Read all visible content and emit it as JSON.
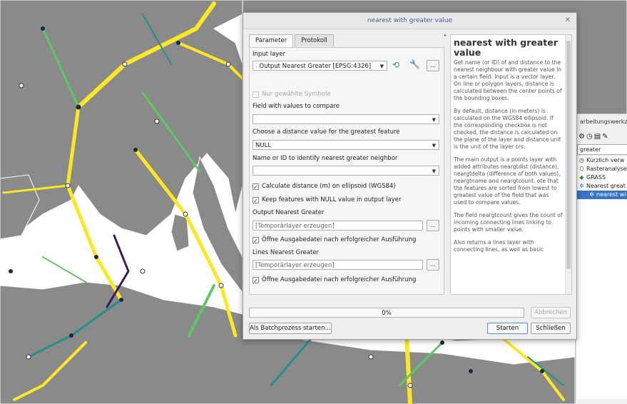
{
  "dialog": {
    "title": "nearest with greater value",
    "tabs": [
      "Parameter",
      "Protokoll"
    ],
    "input_layer_label": "Input layer",
    "input_layer_value": "Output Nearest Greater [EPSG:4326]",
    "selected_only_label": "Nur gewählte Symbole",
    "field_compare_label": "Field with values to compare",
    "field_compare_value": "",
    "distance_label": "Choose a distance value for the greatest feature",
    "distance_value": "NULL",
    "name_label": "Name or ID to identify nearest greater neighbor",
    "name_value": "",
    "calc_ellipsoid_label": "Calculate distance (m) on ellipsoid (WGS84)",
    "keep_null_label": "Keep features with NULL value in output layer",
    "output_label": "Output Nearest Greater",
    "output_placeholder": "[Temporärlayer erzeugen]",
    "open_after_label": "Öffne Ausgabedatei nach erfolgreicher Ausführung",
    "lines_label": "Lines Nearest Greater",
    "lines_placeholder": "[Temporärlayer erzeugen]",
    "open_after_label2": "Öffne Ausgabedatei nach erfolgreicher Ausführung",
    "ellipsis": "...",
    "progress": "0%",
    "cancel": "Abbrechen",
    "batch": "Als Batchprozess starten…",
    "start": "Starten",
    "close": "Schließen"
  },
  "help": {
    "title": "nearest with greater value",
    "paragraphs": [
      "Get name (or ID) of and distance to the nearest neighbour with greater value in a certain field. Input is a vector layer. On line or polygon layers, distance is calculated between the center points of the bounding boxes.",
      "By default, distance (in meters) is calculated on the WGS84 ellipsoid. If the corresponding checkbox is not checked, the distance is calculated on the plane of the layer and distance unit is the unit of the layer crs.",
      "The main output is a points layer with added attributes neargtdist (distance), neargtdelta (difference of both values), neargtname and neargtcount. ote that the features are sorted from lowest to greatest value of the field that was used to compare values.",
      "The field neargtcount gives the count of incoming connecting lines linking to points with smaller value.",
      "Also returns a lines layer with connecting lines, as well as basic"
    ]
  },
  "toolbox": {
    "title": "arbeitungswerkze",
    "search": "greater",
    "items": [
      "Kürzlich verw",
      "Rasteranalyse",
      "GRASS",
      "Nearest great",
      "nearest wi"
    ]
  },
  "colors": {
    "land": "#8a8a8a",
    "sea": "#ffffff",
    "yellow": "#fde725",
    "green": "#5ec962",
    "teal": "#21918c",
    "purple": "#3b1c5a",
    "selection": "#3873c8"
  }
}
